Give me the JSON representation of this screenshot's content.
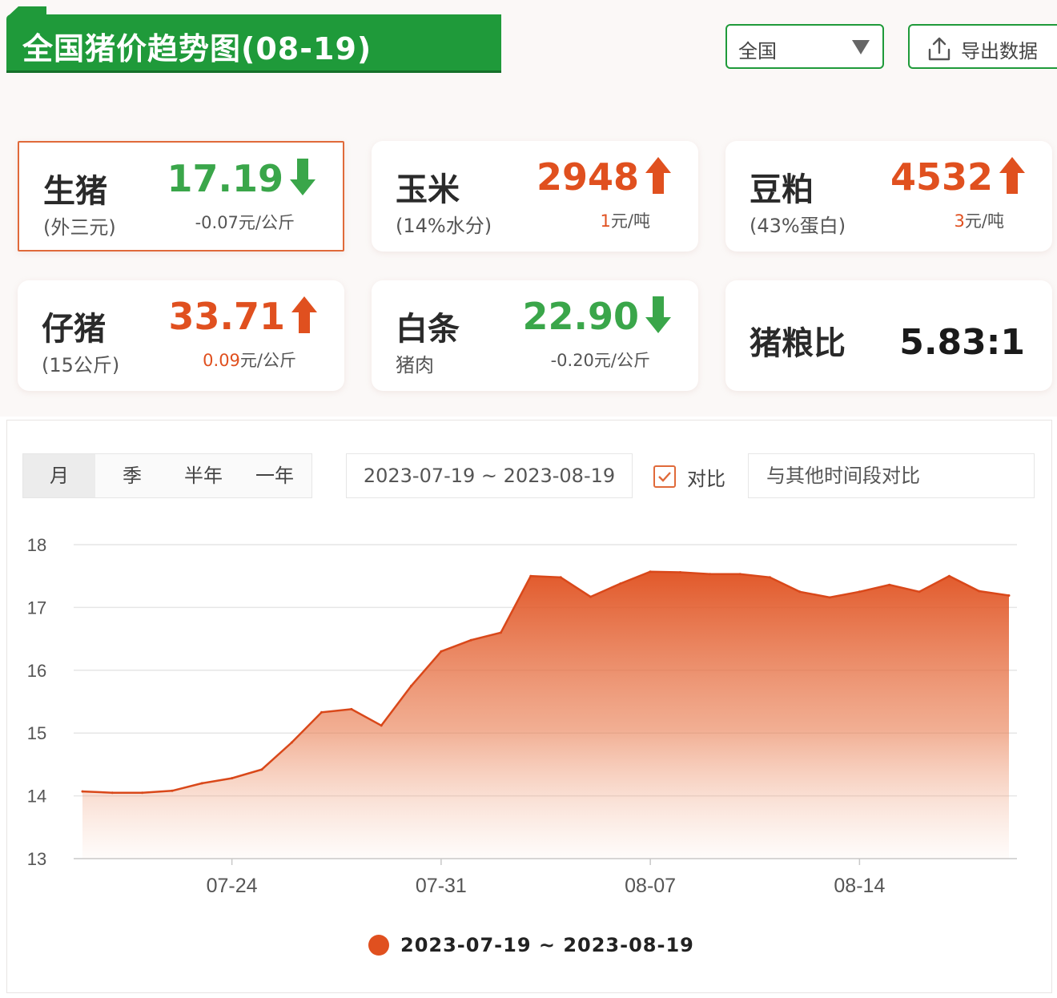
{
  "header": {
    "title": "全国猪价趋势图(08-19)",
    "region": "全国",
    "export_label": "导出数据"
  },
  "cards": [
    {
      "name": "生猪",
      "sub": "(外三元)",
      "price": "17.19",
      "direction": "down",
      "change": "-0.07",
      "unit": "元/公斤"
    },
    {
      "name": "玉米",
      "sub": "(14%水分)",
      "price": "2948",
      "direction": "up",
      "change": "1",
      "unit": "元/吨"
    },
    {
      "name": "豆粕",
      "sub": "(43%蛋白)",
      "price": "4532",
      "direction": "up",
      "change": "3",
      "unit": "元/吨"
    },
    {
      "name": "仔猪",
      "sub": "(15公斤)",
      "price": "33.71",
      "direction": "up",
      "change": "0.09",
      "unit": "元/公斤"
    },
    {
      "name": "白条",
      "sub": "猪肉",
      "price": "22.90",
      "direction": "down",
      "change": "-0.20",
      "unit": "元/公斤"
    }
  ],
  "ratio": {
    "name": "猪粮比",
    "value": "5.83:1"
  },
  "controls": {
    "periods": [
      "月",
      "季",
      "半年",
      "一年"
    ],
    "date_range": "2023-07-19 ~ 2023-08-19",
    "compare_label": "对比",
    "compare_placeholder": "与其他时间段对比"
  },
  "colors": {
    "up": "#e0501f",
    "down": "#3aa64a",
    "brand": "#1f9a3a",
    "area": "#e0501f"
  },
  "chart_data": {
    "type": "area",
    "x": [
      "07-19",
      "07-20",
      "07-21",
      "07-22",
      "07-23",
      "07-24",
      "07-25",
      "07-26",
      "07-27",
      "07-28",
      "07-29",
      "07-30",
      "07-31",
      "08-01",
      "08-02",
      "08-03",
      "08-04",
      "08-05",
      "08-06",
      "08-07",
      "08-08",
      "08-09",
      "08-10",
      "08-11",
      "08-12",
      "08-13",
      "08-14",
      "08-15",
      "08-16",
      "08-17",
      "08-18",
      "08-19"
    ],
    "series": [
      {
        "name": "2023-07-19 ~ 2023-08-19",
        "values": [
          14.07,
          14.05,
          14.05,
          14.08,
          14.2,
          14.28,
          14.42,
          14.85,
          15.33,
          15.38,
          15.12,
          15.75,
          16.3,
          16.48,
          16.6,
          17.5,
          17.48,
          17.17,
          17.38,
          17.57,
          17.56,
          17.53,
          17.53,
          17.48,
          17.25,
          17.16,
          17.25,
          17.36,
          17.25,
          17.5,
          17.26,
          17.19
        ]
      }
    ],
    "xticks": [
      "07-24",
      "07-31",
      "08-07",
      "08-14"
    ],
    "ylim": [
      13,
      18
    ],
    "yticks": [
      13,
      14,
      15,
      16,
      17,
      18
    ],
    "grid": true,
    "legend": "bottom"
  }
}
